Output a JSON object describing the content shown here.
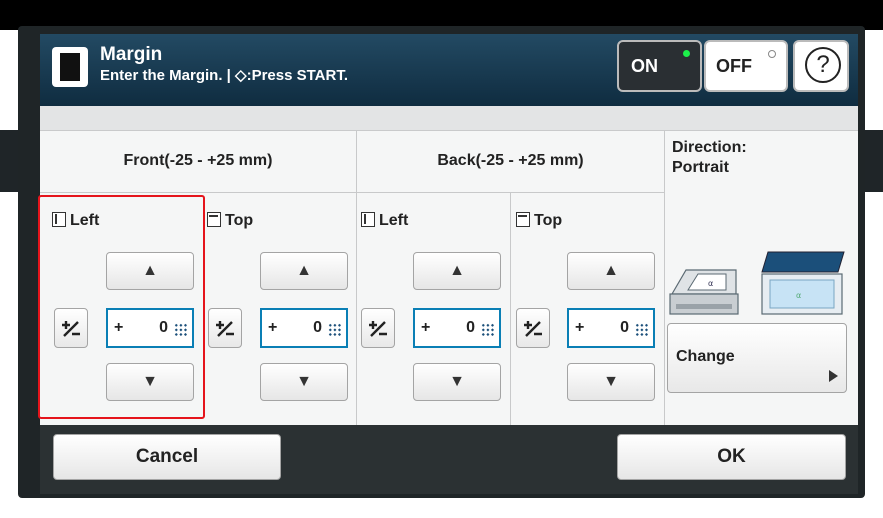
{
  "header": {
    "title": "Margin",
    "subtitle": "Enter the Margin. | ◇:Press START.",
    "on_label": "ON",
    "off_label": "OFF",
    "help_symbol": "?"
  },
  "front": {
    "heading": "Front(-25 - +25 mm)",
    "left": {
      "label": "Left",
      "sign": "+",
      "value": "0"
    },
    "top": {
      "label": "Top",
      "sign": "+",
      "value": "0"
    }
  },
  "back": {
    "heading": "Back(-25 - +25 mm)",
    "left": {
      "label": "Left",
      "sign": "+",
      "value": "0"
    },
    "top": {
      "label": "Top",
      "sign": "+",
      "value": "0"
    }
  },
  "direction": {
    "label": "Direction:",
    "value": "Portrait",
    "change_label": "Change"
  },
  "controls": {
    "up_arrow": "▲",
    "down_arrow": "▼",
    "plus_minus": "+/-"
  },
  "footer": {
    "cancel_label": "Cancel",
    "ok_label": "OK"
  },
  "icons": [
    "margin-icon",
    "start-icon",
    "help-icon",
    "left-margin-icon",
    "top-margin-icon",
    "keypad-icon",
    "adf-scanner-icon",
    "flatbed-icon",
    "arrow-right-icon"
  ],
  "colors": {
    "header": "#1b3d55",
    "value_border": "#0a7fb5",
    "highlight": "#e5141b",
    "on_indicator": "#1cf04a"
  }
}
